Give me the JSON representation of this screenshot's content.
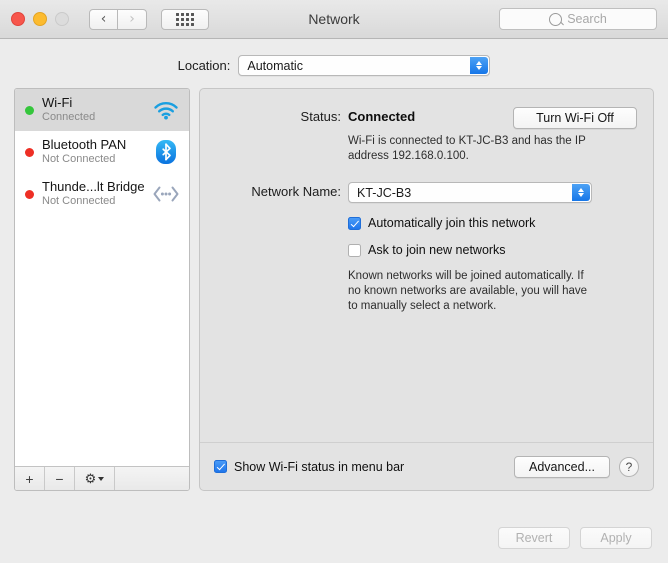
{
  "window": {
    "title": "Network",
    "traffic_lights": [
      "close",
      "minimize",
      "zoom"
    ],
    "nav_back": "‹",
    "nav_forward": "›",
    "grid_button": "show-all-icon"
  },
  "search": {
    "placeholder": "Search",
    "value": "",
    "icon": "search-icon"
  },
  "location": {
    "label": "Location:",
    "value": "Automatic"
  },
  "sidebar": {
    "services": [
      {
        "name": "Wi-Fi",
        "state": "Connected",
        "dot_color": "#35c63c",
        "icon": "wifi-icon",
        "selected": true
      },
      {
        "name": "Bluetooth PAN",
        "state": "Not Connected",
        "dot_color": "#ee2f25",
        "icon": "bluetooth-icon",
        "selected": false
      },
      {
        "name": "Thunde...lt Bridge",
        "state": "Not Connected",
        "dot_color": "#ee2f25",
        "icon": "thunderbolt-icon",
        "selected": false
      }
    ],
    "toolbar": {
      "add": "+",
      "remove": "−",
      "action": "gear-icon"
    }
  },
  "main": {
    "status_label": "Status:",
    "status_value": "Connected",
    "turn_off_button": "Turn Wi-Fi Off",
    "status_description": "Wi-Fi is connected to KT-JC-B3 and has the IP address 192.168.0.100.",
    "network_name_label": "Network Name:",
    "network_name_value": "KT-JC-B3",
    "auto_join_label": "Automatically join this network",
    "auto_join_checked": true,
    "ask_join_label": "Ask to join new networks",
    "ask_join_checked": false,
    "help_text": "Known networks will be joined automatically. If no known networks are available, you will have to manually select a network.",
    "show_status_label": "Show Wi-Fi status in menu bar",
    "show_status_checked": true,
    "advanced_button": "Advanced...",
    "help_button": "?"
  },
  "footer": {
    "revert_button": "Revert",
    "apply_button": "Apply"
  },
  "colors": {
    "accent_blue": "#1f76ec",
    "wifi_blue": "#1a9fe0",
    "connected_green": "#35c63c",
    "disconnected_red": "#ee2f25"
  }
}
